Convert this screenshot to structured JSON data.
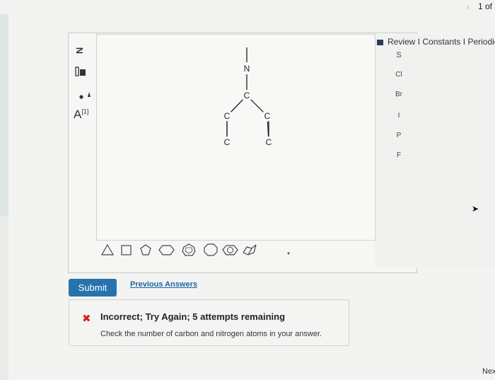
{
  "pagination": {
    "label": "1 of",
    "back_icon": "‹"
  },
  "left_toolbar": {
    "n_label": "N",
    "charge_label": "A",
    "charge_sup": "[1]"
  },
  "molecule": {
    "atoms": [
      {
        "id": "N1",
        "label": "N"
      },
      {
        "id": "C1",
        "label": "C"
      },
      {
        "id": "C2",
        "label": "C"
      },
      {
        "id": "C3",
        "label": "C"
      },
      {
        "id": "C4",
        "label": "C"
      },
      {
        "id": "C5",
        "label": "C"
      }
    ],
    "bonds": [
      [
        "N1",
        "C1"
      ],
      [
        "C1",
        "C2"
      ],
      [
        "C1",
        "C3"
      ],
      [
        "C2",
        "C4"
      ],
      [
        "C3",
        "C5"
      ]
    ]
  },
  "links": {
    "review": "Review",
    "constants": "Constants",
    "periodic": "Periodic",
    "separator": "I"
  },
  "elements": [
    "S",
    "Cl",
    "Br",
    "I",
    "P",
    "F"
  ],
  "shapes": [
    "triangle",
    "square",
    "pentagon",
    "hexagon",
    "heptagon",
    "octagon",
    "circle",
    "chair"
  ],
  "actions": {
    "submit": "Submit",
    "previous_answers": "Previous Answers"
  },
  "feedback": {
    "title": "Incorrect; Try Again; 5 attempts remaining",
    "message": "Check the number of carbon and nitrogen atoms in your answer."
  },
  "next_label": "Nex"
}
